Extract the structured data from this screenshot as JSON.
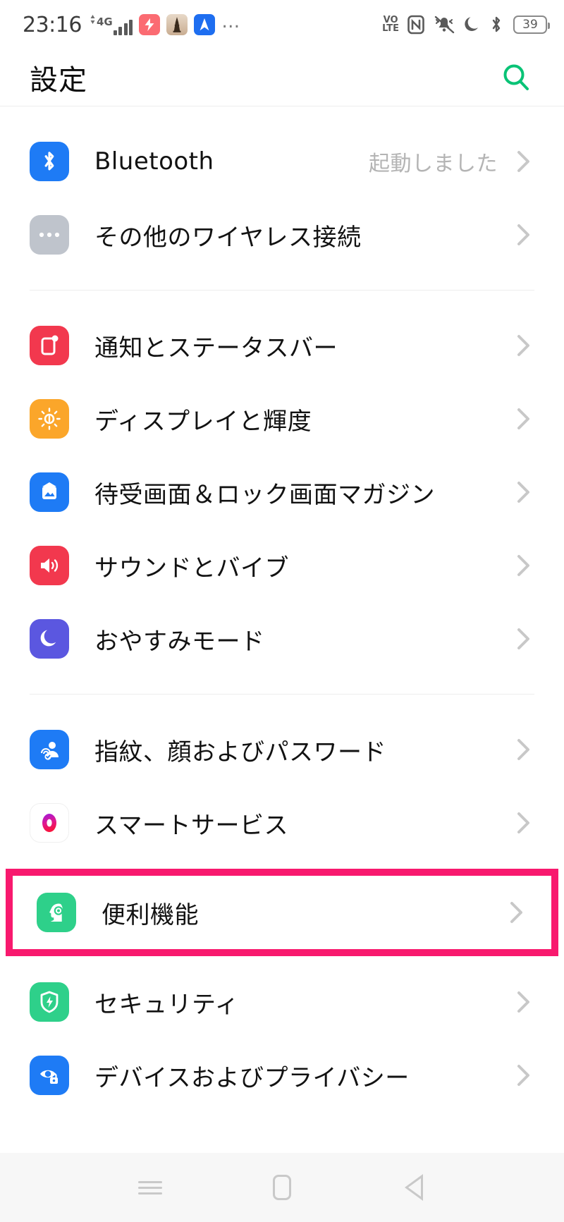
{
  "status_bar": {
    "time": "23:16",
    "network_type": "4G",
    "signal_bars": 4,
    "app_icons": [
      "shortcut-app-icon",
      "tower-app-icon",
      "navigation-app-icon"
    ],
    "overflow": "…",
    "volte_line1": "VO",
    "volte_line2": "LTE",
    "nfc": "N",
    "icons_right": [
      "volte-icon",
      "nfc-icon",
      "ringer-silent-icon",
      "do-not-disturb-icon",
      "bluetooth-icon"
    ],
    "battery_level": "39"
  },
  "header": {
    "title": "設定",
    "search_icon": "search-icon"
  },
  "groups": [
    {
      "id": "connectivity",
      "items": [
        {
          "id": "bluetooth",
          "label": "Bluetooth",
          "value": "起動しました",
          "icon": "bluetooth-icon",
          "icon_color": "#1E7BF5",
          "highlighted": false
        },
        {
          "id": "other-wireless",
          "label": "その他のワイヤレス接続",
          "value": "",
          "icon": "more-dots-icon",
          "icon_color": "#BFC4CC",
          "highlighted": false
        }
      ]
    },
    {
      "id": "device",
      "items": [
        {
          "id": "notifications-status-bar",
          "label": "通知とステータスバー",
          "value": "",
          "icon": "notification-icon",
          "icon_color": "#F2384E",
          "highlighted": false
        },
        {
          "id": "display-brightness",
          "label": "ディスプレイと輝度",
          "value": "",
          "icon": "brightness-sun-icon",
          "icon_color": "#FBA62A",
          "highlighted": false
        },
        {
          "id": "wallpaper-lockscreen-magazine",
          "label": "待受画面＆ロック画面マガジン",
          "value": "",
          "icon": "wallpaper-icon",
          "icon_color": "#1E7BF5",
          "highlighted": false
        },
        {
          "id": "sound-vibration",
          "label": "サウンドとバイブ",
          "value": "",
          "icon": "speaker-icon",
          "icon_color": "#F2384E",
          "highlighted": false
        },
        {
          "id": "do-not-disturb",
          "label": "おやすみモード",
          "value": "",
          "icon": "moon-icon",
          "icon_color": "#5B57E0",
          "highlighted": false
        }
      ]
    },
    {
      "id": "personal",
      "items": [
        {
          "id": "fingerprint-face-password",
          "label": "指紋、顔およびパスワード",
          "value": "",
          "icon": "fingerprint-face-icon",
          "icon_color": "#1E7BF5",
          "highlighted": false
        },
        {
          "id": "smart-services",
          "label": "スマートサービス",
          "value": "",
          "icon": "smart-services-ring-icon",
          "icon_color": "#FFFFFF",
          "highlighted": false
        },
        {
          "id": "convenience-features",
          "label": "便利機能",
          "value": "",
          "icon": "smart-head-icon",
          "icon_color": "#2ED08A",
          "highlighted": true
        },
        {
          "id": "security",
          "label": "セキュリティ",
          "value": "",
          "icon": "shield-icon",
          "icon_color": "#2ED08A",
          "highlighted": false
        },
        {
          "id": "device-privacy",
          "label": "デバイスおよびプライバシー",
          "value": "",
          "icon": "privacy-eye-icon",
          "icon_color": "#1E7BF5",
          "highlighted": false
        }
      ]
    }
  ],
  "highlight": {
    "color": "#F8196E",
    "target": "便利機能"
  },
  "navbar": {
    "recents_label": "recents-button",
    "home_label": "home-button",
    "back_label": "back-button"
  },
  "colors": {
    "accent_green": "#09C376",
    "highlight_pink": "#F8196E",
    "text_primary": "#121212",
    "text_secondary": "#B4B4B4",
    "background": "#FFFFFF"
  }
}
